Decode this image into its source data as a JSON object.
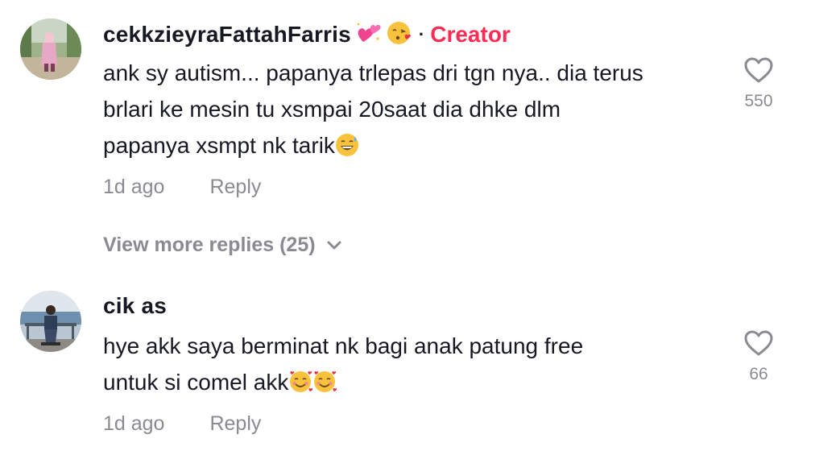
{
  "comments": [
    {
      "username": "cekkzieyraFattahFarris",
      "username_emojis": [
        "sparkling-hearts-emoji",
        "kissing-face-emoji"
      ],
      "badge": "Creator",
      "lines": [
        "ank sy autism... papanya trlepas dri tgn nya.. dia terus",
        "brlari ke mesin tu xsmpai 20saat dia dhke dlm",
        "papanya xsmpt nk tarik"
      ],
      "trailing_emoji": "grinning-sweat-emoji",
      "time": "1d ago",
      "reply_label": "Reply",
      "likes": "550",
      "view_more": "View more replies (25)"
    },
    {
      "username": "cik as",
      "lines": [
        "hye akk saya berminat nk bagi anak patung free",
        "untuk si comel akk"
      ],
      "trailing_emoji": "smiling-face-with-hearts-emoji",
      "time": "1d ago",
      "reply_label": "Reply",
      "likes": "66"
    }
  ],
  "colors": {
    "text": "#161823",
    "muted": "#8a8b91",
    "creator_badge": "#fe2c55"
  },
  "icons": {
    "like": "heart-outline-icon",
    "expand": "chevron-down-icon"
  }
}
